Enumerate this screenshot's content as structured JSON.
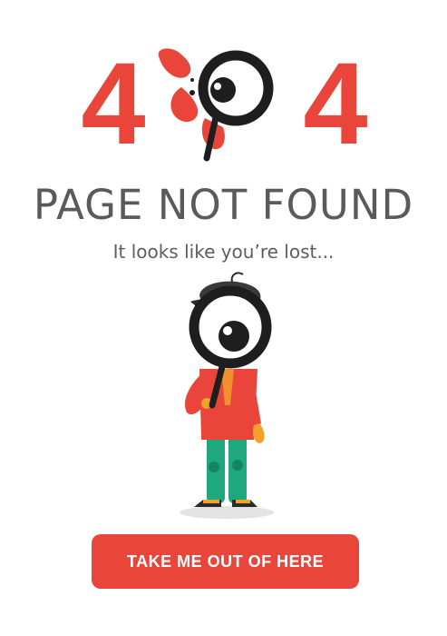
{
  "hero": {
    "code_left": "4",
    "code_right": "4"
  },
  "title": "PAGE NOT FOUND",
  "subtitle": "It looks like you’re lost...",
  "cta": {
    "label": "TAKE ME OUT OF HERE"
  },
  "colors": {
    "accent": "#e9453a",
    "text": "#5a5a5a",
    "dark": "#1e1e1e",
    "green": "#1fa77d"
  },
  "icons": [
    "magnifying-glass-icon",
    "eye-icon",
    "explorer-character-illustration"
  ]
}
